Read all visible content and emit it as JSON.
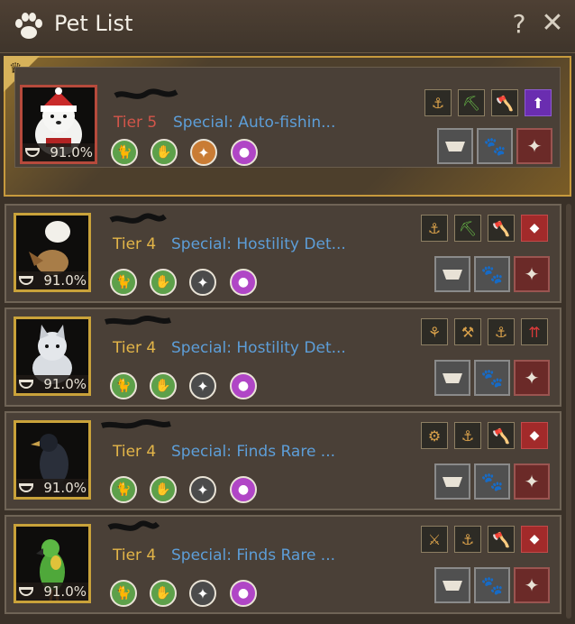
{
  "window": {
    "title": "Pet List",
    "help_label": "?",
    "close_label": "✕"
  },
  "icons": {
    "title": "paw-icon",
    "crown": "crown-icon",
    "hunger": "pet-bowl-icon",
    "skills": [
      "cat-skill-icon",
      "paw-hand-skill-icon",
      "compass-skill-icon",
      "potion-skill-icon"
    ],
    "buttons": [
      "feed-bowl-icon",
      "paw-question-icon",
      "box-release-icon"
    ]
  },
  "colors": {
    "tier5": "#d2554a",
    "tier4": "#e3b548",
    "special": "#5d9ed8",
    "featured_border": "#c79a3d"
  },
  "pets": [
    {
      "tier": "Tier 5",
      "special": "Special: Auto-fishin...",
      "hunger": "91.0%",
      "portrait": "polar-bear-santa-hat",
      "skills": [
        "green",
        "green",
        "orange",
        "purple"
      ],
      "traits": [
        {
          "icon": "hook-rank-icon",
          "color": "plain"
        },
        {
          "icon": "pickaxe-rank-icon",
          "color": "plain"
        },
        {
          "icon": "axe-rank-icon",
          "color": "plain"
        },
        {
          "icon": "person-up-icon",
          "color": "purple"
        }
      ]
    },
    {
      "tier": "Tier 4",
      "special": "Special: Hostility Det...",
      "hunger": "91.0%",
      "portrait": "eagle-egg-pet",
      "skills": [
        "green",
        "green",
        "grey",
        "purple"
      ],
      "traits": [
        {
          "icon": "hook-rank-icon",
          "color": "plain"
        },
        {
          "icon": "pickaxe-icon",
          "color": "plain"
        },
        {
          "icon": "axe-rank-icon",
          "color": "plain"
        },
        {
          "icon": "red-shield-icon",
          "color": "red"
        }
      ]
    },
    {
      "tier": "Tier 4",
      "special": "Special: Hostility Det...",
      "hunger": "91.0%",
      "portrait": "white-husky-pup",
      "skills": [
        "green",
        "green",
        "grey",
        "purple"
      ],
      "traits": [
        {
          "icon": "wheat-rank-icon",
          "color": "plain"
        },
        {
          "icon": "hammer-icon",
          "color": "plain"
        },
        {
          "icon": "hook-rank-icon",
          "color": "plain"
        },
        {
          "icon": "arrows-up-icon",
          "color": "plain"
        }
      ]
    },
    {
      "tier": "Tier 4",
      "special": "Special: Finds Rare ...",
      "hunger": "91.0%",
      "portrait": "black-raven",
      "skills": [
        "green",
        "green",
        "grey",
        "purple"
      ],
      "traits": [
        {
          "icon": "carriage-icon",
          "color": "plain"
        },
        {
          "icon": "hook-rank-icon",
          "color": "plain"
        },
        {
          "icon": "axe-rank-icon",
          "color": "plain"
        },
        {
          "icon": "red-shield-icon",
          "color": "red"
        }
      ]
    },
    {
      "tier": "Tier 4",
      "special": "Special: Finds Rare ...",
      "hunger": "91.0%",
      "portrait": "green-parrot",
      "skills": [
        "green",
        "green",
        "grey",
        "purple"
      ],
      "traits": [
        {
          "icon": "shovel-rank-icon",
          "color": "plain"
        },
        {
          "icon": "hook-rank-icon",
          "color": "plain"
        },
        {
          "icon": "axe-rank-icon",
          "color": "plain"
        },
        {
          "icon": "red-shield-icon",
          "color": "red"
        }
      ]
    }
  ]
}
